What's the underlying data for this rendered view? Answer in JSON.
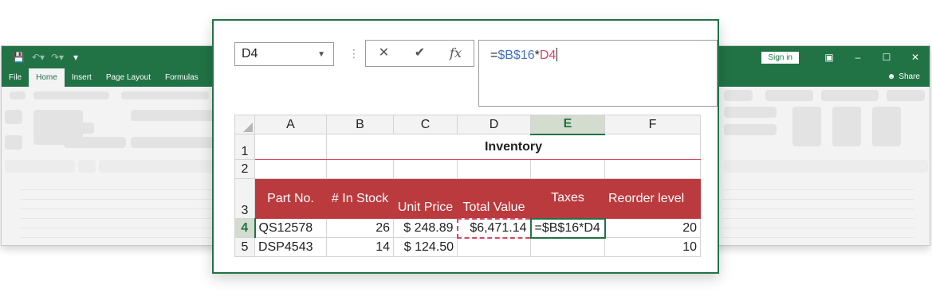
{
  "app": {
    "tabs": [
      "File",
      "Home",
      "Insert",
      "Page Layout",
      "Formulas"
    ],
    "active_tab": "Home",
    "sign_in_label": "Sign in",
    "share_label": "Share",
    "accent_color": "#217346"
  },
  "formula_bar": {
    "name_box": "D4",
    "formula_parts": {
      "eq": "=",
      "ref1": "$B$16",
      "op": "*",
      "ref2": "D4"
    }
  },
  "sheet": {
    "columns": [
      "A",
      "B",
      "C",
      "D",
      "E",
      "F"
    ],
    "selected_column": "E",
    "selected_row": "4",
    "rows": {
      "r1": {
        "num": "1",
        "title": "Inventory"
      },
      "r2": {
        "num": "2"
      },
      "r3": {
        "num": "3",
        "headers": [
          "Part No.",
          "# In Stock",
          "Unit Price",
          "Total Value",
          "Taxes",
          "Reorder level"
        ]
      },
      "r4": {
        "num": "4",
        "cells": [
          "QS12578",
          "26",
          "$ 248.89",
          "$6,471.14",
          "=$B$16*D4",
          "20"
        ]
      },
      "r5": {
        "num": "5",
        "cells": [
          "DSP4543",
          "14",
          "$ 124.50",
          "",
          "",
          "10"
        ]
      }
    }
  }
}
